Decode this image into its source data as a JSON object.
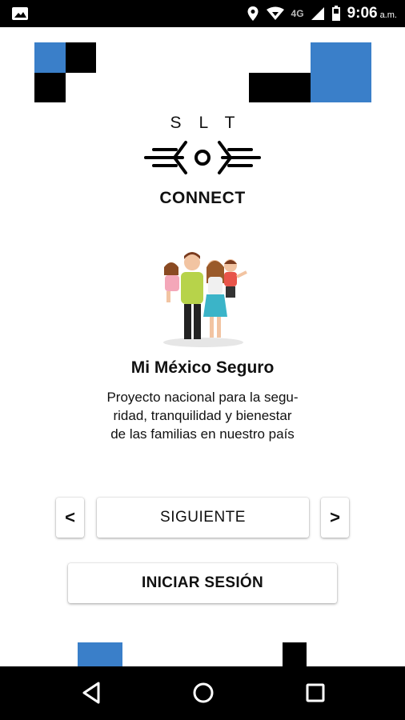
{
  "status_bar": {
    "network": "4G",
    "time": "9:06",
    "ampm": "a.m.",
    "icons": [
      "image-icon",
      "location-icon",
      "wifi-icon",
      "signal-icon",
      "battery-icon"
    ]
  },
  "logo": {
    "letters": "SLT",
    "connect": "CONNECT"
  },
  "content": {
    "title": "Mi México Seguro",
    "description_lines": [
      "Proyecto nacional para la segu-",
      "ridad, tranquilidad y bienestar",
      "de las familias en nuestro país"
    ]
  },
  "buttons": {
    "prev": "<",
    "next_main": "SIGUIENTE",
    "next": ">",
    "login": "INICIAR SESIÓN"
  },
  "colors": {
    "accent_blue": "#3a7fc9",
    "black": "#000000"
  },
  "nav_bar": {
    "icons": [
      "back-icon",
      "home-icon",
      "recents-icon"
    ]
  }
}
